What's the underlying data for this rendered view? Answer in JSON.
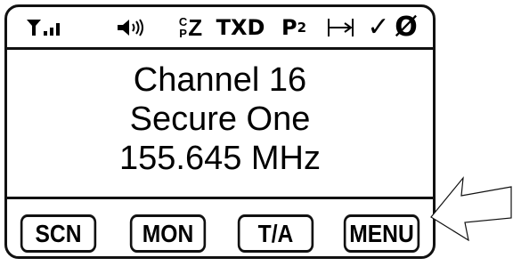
{
  "status_bar": {
    "signal_icon": "signal-strength-icon",
    "speaker_icon": "speaker-volume-icon",
    "cp_top": "C",
    "cp_bottom": "P",
    "cp_symbol": "Z",
    "txd": "TXD",
    "priority_letter": "P",
    "priority_number": "2",
    "range_icon": "range-bracket-icon",
    "check": "✓",
    "null_symbol": "Ø"
  },
  "display": {
    "channel": "Channel 16",
    "zone": "Secure One",
    "frequency": "155.645 MHz"
  },
  "softkeys": {
    "scn": "SCN",
    "mon": "MON",
    "ta": "T/A",
    "menu": "MENU"
  },
  "callout": {
    "arrow_icon": "pointer-arrow-icon",
    "target": "MENU"
  }
}
